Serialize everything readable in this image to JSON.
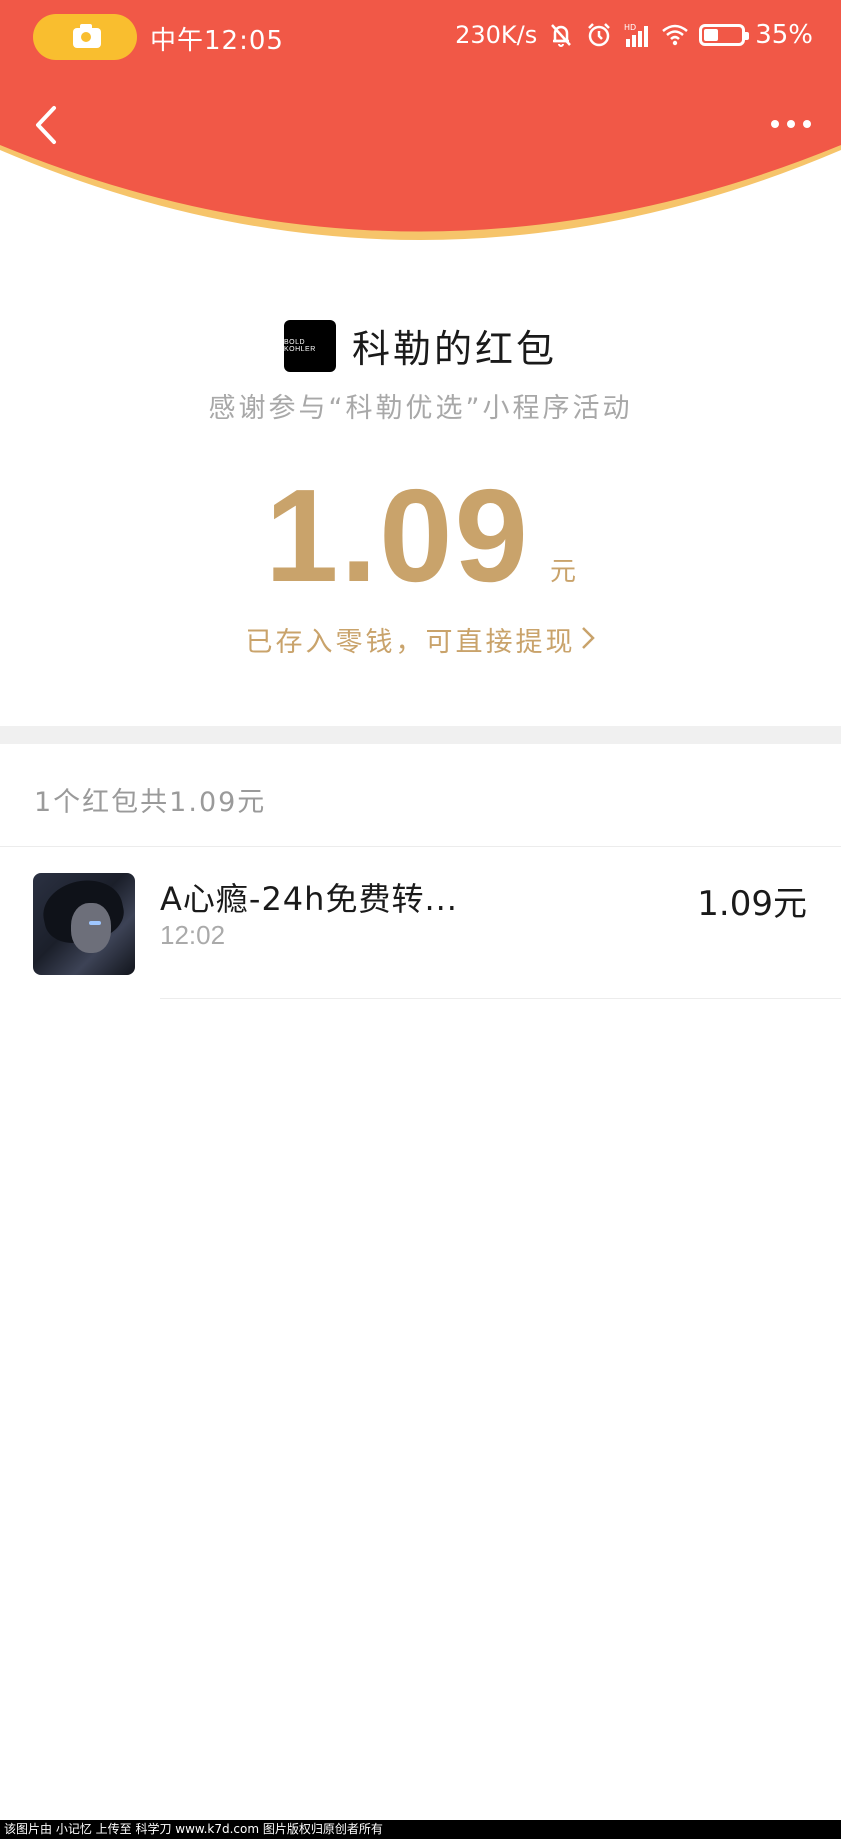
{
  "status_bar": {
    "time": "中午12:05",
    "net_speed": "230K/s",
    "signal_label": "HD",
    "battery": "35%"
  },
  "nav": {
    "back_icon": "chevron-left-icon",
    "more_icon": "more-dots-icon"
  },
  "envelope": {
    "brand_logo_text": "BOLD KOHLER",
    "title": "科勒的红包",
    "subtitle": "感谢参与“科勒优选”小程序活动",
    "amount": "1.09",
    "unit": "元",
    "deposit_text": "已存入零钱，可直接提现"
  },
  "summary": "1个红包共1.09元",
  "records": [
    {
      "name": "A心瘾-24h免费转...",
      "time": "12:02",
      "amount": "1.09元"
    }
  ],
  "footer": "该图片由 小记忆 上传至 科学刀 www.k7d.com 图片版权归原创者所有",
  "colors": {
    "header_red": "#f15847",
    "header_edge": "#f6c46a",
    "gold": "#c9a36b",
    "camera_pill": "#f9be2f"
  }
}
